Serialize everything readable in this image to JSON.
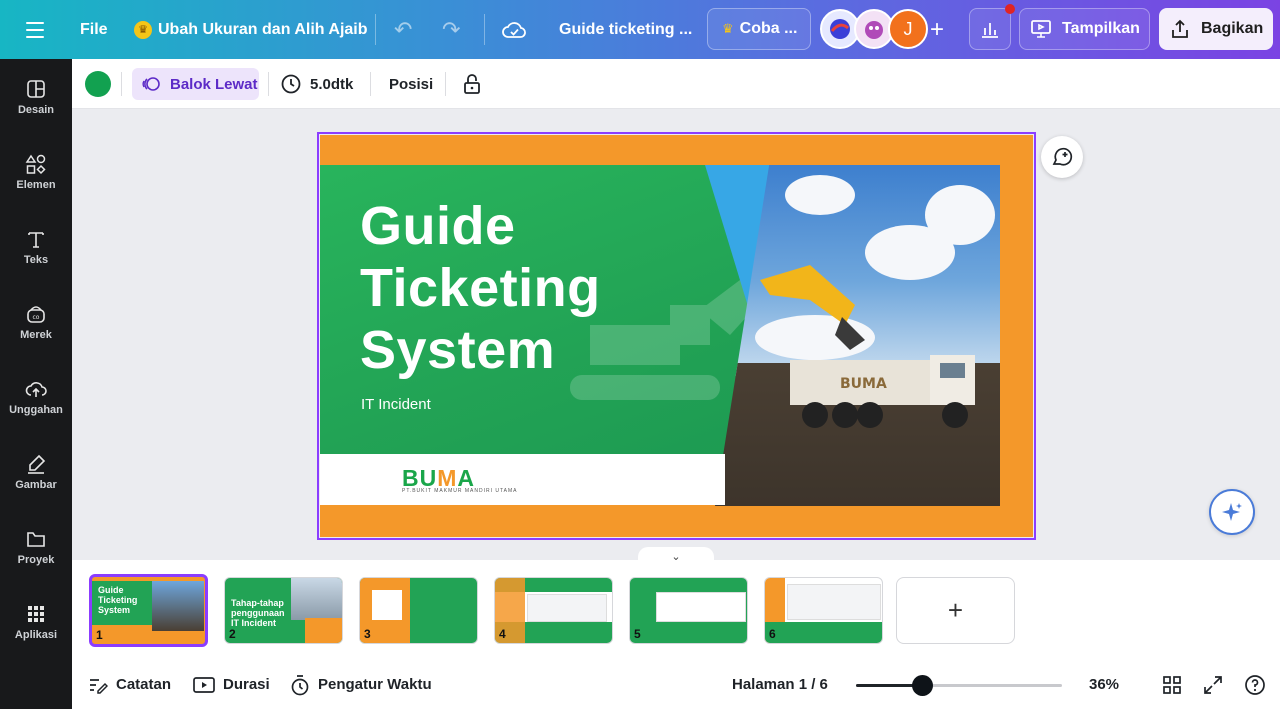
{
  "topbar": {
    "file_label": "File",
    "resize_label": "Ubah Ukuran dan Alih Ajaib",
    "doc_title": "Guide ticketing ...",
    "try_label": "Coba ...",
    "avatar3_initial": "J",
    "present_label": "Tampilkan",
    "share_label": "Bagikan"
  },
  "sidebar": {
    "items": [
      {
        "label": "Desain",
        "icon": "design-icon"
      },
      {
        "label": "Elemen",
        "icon": "elements-icon"
      },
      {
        "label": "Teks",
        "icon": "text-icon"
      },
      {
        "label": "Merek",
        "icon": "brand-icon"
      },
      {
        "label": "Unggahan",
        "icon": "upload-icon"
      },
      {
        "label": "Gambar",
        "icon": "draw-icon"
      },
      {
        "label": "Proyek",
        "icon": "folder-icon"
      },
      {
        "label": "Aplikasi",
        "icon": "apps-icon"
      }
    ]
  },
  "toolbar": {
    "color": "#12a150",
    "animation_label": "Balok Lewat",
    "duration_label": "5.0dtk",
    "position_label": "Posisi"
  },
  "slide": {
    "title_line1": "Guide",
    "title_line2": "Ticketing",
    "title_line3": "System",
    "subtitle": "IT Incident",
    "logo_text_a": "BU",
    "logo_text_m": "M",
    "logo_text_b": "A",
    "logo_sub": "PT.BUKIT MAKMUR MANDIRI UTAMA",
    "truck_text": "BUMA"
  },
  "filmstrip": {
    "thumbs": [
      {
        "num": "1",
        "text": "Guide Ticketing System"
      },
      {
        "num": "2",
        "text": "Tahap-tahap penggunaan IT Incident"
      },
      {
        "num": "3",
        "text": ""
      },
      {
        "num": "4",
        "text": ""
      },
      {
        "num": "5",
        "text": ""
      },
      {
        "num": "6",
        "text": ""
      }
    ],
    "add_label": "+"
  },
  "bottombar": {
    "notes_label": "Catatan",
    "duration_label": "Durasi",
    "timer_label": "Pengatur Waktu",
    "page_indicator": "Halaman 1 / 6",
    "zoom": "36%",
    "zoom_fraction": 0.32
  },
  "colors": {
    "accent": "#8b3dff",
    "slide_orange": "#f4982a",
    "slide_green": "#22a355"
  }
}
